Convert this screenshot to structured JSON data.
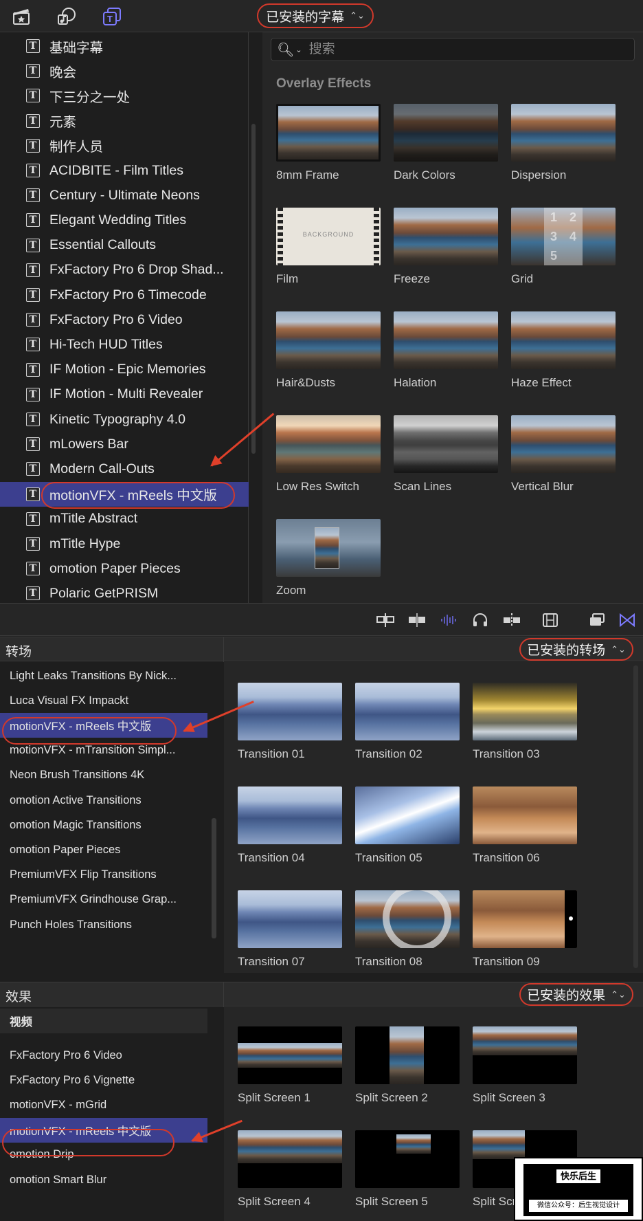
{
  "titles_browser": {
    "dropdown_label": "已安装的字幕",
    "search_placeholder": "搜索",
    "section_heading": "Overlay Effects",
    "list_items": [
      "基础字幕",
      "晚会",
      "下三分之一处",
      "元素",
      "制作人员",
      "ACIDBITE - Film Titles",
      "Century - Ultimate Neons",
      "Elegant Wedding Titles",
      "Essential Callouts",
      "FxFactory Pro 6 Drop Shad...",
      "FxFactory Pro 6 Timecode",
      "FxFactory Pro 6 Video",
      "Hi-Tech HUD Titles",
      "IF Motion - Epic Memories",
      "IF Motion - Multi Revealer",
      "Kinetic Typography 4.0",
      "mLowers Bar",
      "Modern Call-Outs",
      "motionVFX - mReels 中文版",
      "mTitle Abstract",
      "mTitle Hype",
      "omotion Paper Pieces",
      "Polaric GetPRISM"
    ],
    "selected_index": 18,
    "thumbnails": [
      "8mm Frame",
      "Dark Colors",
      "Dispersion",
      "Film",
      "Freeze",
      "Grid",
      "Hair&Dusts",
      "Halation",
      "Haze Effect",
      "Low Res Switch",
      "Scan Lines",
      "Vertical Blur",
      "Zoom"
    ],
    "film_card_text": "BACKGROUND",
    "grid_numbers": [
      "1",
      "2",
      "3",
      "4",
      "5"
    ]
  },
  "transitions": {
    "panel_title": "转场",
    "dropdown_label": "已安装的转场",
    "list_items": [
      "Light Leaks Transitions By Nick...",
      "Luca Visual FX Impackt",
      "motionVFX - mReels 中文版",
      "motionVFX - mTransition Simpl...",
      "Neon Brush Transitions 4K",
      "omotion Active Transitions",
      "omotion Magic Transitions",
      "omotion Paper Pieces",
      "PremiumVFX Flip Transitions",
      "PremiumVFX Grindhouse Grap...",
      "Punch Holes Transitions"
    ],
    "selected_index": 2,
    "thumbnails": [
      "Transition 01",
      "Transition 02",
      "Transition 03",
      "Transition 04",
      "Transition 05",
      "Transition 06",
      "Transition 07",
      "Transition 08",
      "Transition 09"
    ]
  },
  "effects": {
    "panel_title": "效果",
    "dropdown_label": "已安装的效果",
    "group_label": "视频",
    "list_items": [
      "FxFactory Pro 6 Video",
      "FxFactory Pro 6 Vignette",
      "motionVFX - mGrid",
      "motionVFX - mReels 中文版",
      "omotion Drip",
      "omotion Smart Blur"
    ],
    "selected_index": 3,
    "thumbnails": [
      "Split Screen 1",
      "Split Screen 2",
      "Split Screen 3",
      "Split Screen 4",
      "Split Screen 5",
      "Split Scre"
    ]
  },
  "watermark": {
    "title": "快乐后生",
    "subtitle": "微信公众号：后生视觉设计"
  },
  "colors": {
    "selection": "#3c3f8f",
    "accent": "#7d7bff",
    "highlight_ring": "#d2392b"
  },
  "icons": {
    "top_toolbar": [
      "clapper-star-icon",
      "music-photo-icon",
      "titles-generators-icon"
    ],
    "timeline_toolbar": [
      "clip-connect-icon",
      "blade-icon",
      "audio-waveform-icon",
      "headphones-icon",
      "snapping-icon",
      "filmstrip-icon",
      "window-icon",
      "bowtie-icon"
    ]
  }
}
